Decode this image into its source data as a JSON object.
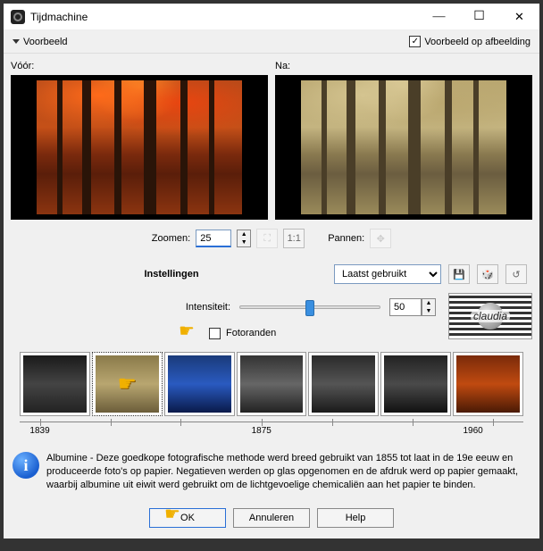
{
  "window": {
    "title": "Tijdmachine"
  },
  "toolbar": {
    "dropdown": "Voorbeeld",
    "checkbox_label": "Voorbeeld op afbeelding",
    "checkbox_checked": true
  },
  "preview": {
    "before_label": "Vóór:",
    "after_label": "Na:",
    "zoom_label": "Zoomen:",
    "zoom_value": "25",
    "fit_btn": "1:1",
    "pan_label": "Pannen:"
  },
  "settings": {
    "label": "Instellingen",
    "preset": "Laatst gebruikt",
    "save_icon": "floppy-icon",
    "random_icon": "dice-icon",
    "reset_icon": "reset-icon"
  },
  "intensity": {
    "label": "Intensiteit:",
    "value": "50"
  },
  "fotoranden": {
    "label": "Fotoranden",
    "checked": false
  },
  "logo": {
    "text": "claudia"
  },
  "timeline": {
    "years": [
      "1839",
      "1875",
      "1960"
    ],
    "selected_index": 1
  },
  "info": {
    "text": "Albumine - Deze goedkope fotografische methode werd breed gebruikt van 1855 tot laat in de 19e eeuw en produceerde foto's op papier. Negatieven werden op glas opgenomen en de afdruk werd op papier gemaakt, waarbij albumine uit eiwit werd gebruikt om de lichtgevoelige chemicaliën aan het papier te binden."
  },
  "buttons": {
    "ok": "OK",
    "cancel": "Annuleren",
    "help": "Help"
  }
}
